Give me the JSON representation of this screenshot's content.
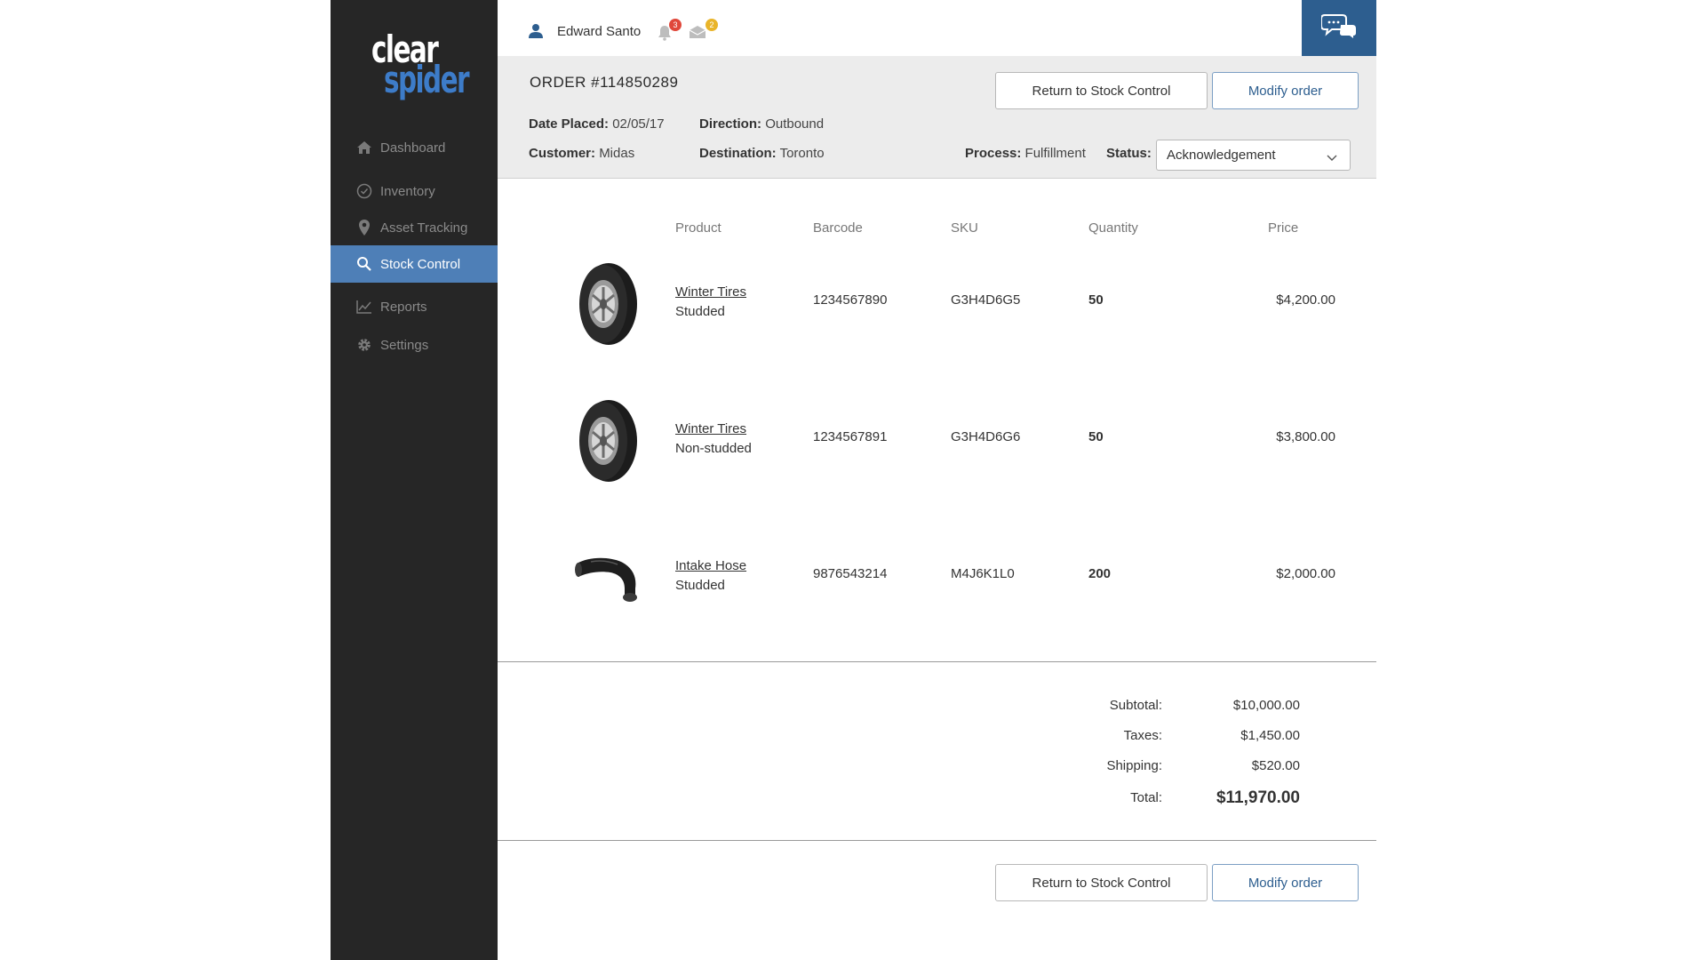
{
  "brand": {
    "logo_line1": "clear",
    "logo_line2": "spider",
    "accent": "#4e7fb7",
    "sidebar_bg": "#262626",
    "chat_bg": "#2d5e8f"
  },
  "sidebar": {
    "items": [
      {
        "label": "Dashboard",
        "icon": "home-icon",
        "active": false
      },
      {
        "label": "Inventory",
        "icon": "check-circle-icon",
        "active": false
      },
      {
        "label": "Asset Tracking",
        "icon": "map-pin-icon",
        "active": false
      },
      {
        "label": "Stock Control",
        "icon": "search-icon",
        "active": true
      },
      {
        "label": "Reports",
        "icon": "line-chart-icon",
        "active": false
      },
      {
        "label": "Settings",
        "icon": "gear-icon",
        "active": false
      }
    ]
  },
  "topbar": {
    "user_name": "Edward Santo",
    "notifications_count": "3",
    "messages_count": "2",
    "chat_icon": "chat-bubbles-icon"
  },
  "order": {
    "title": "ORDER #114850289",
    "date_placed_label": "Date Placed:",
    "date_placed": "02/05/17",
    "direction_label": "Direction:",
    "direction": "Outbound",
    "customer_label": "Customer:",
    "customer": "Midas",
    "destination_label": "Destination:",
    "destination": "Toronto",
    "process_label": "Process:",
    "process": "Fulfillment",
    "status_label": "Status:",
    "status": "Acknowledgement",
    "return_button": "Return to Stock Control",
    "modify_button": "Modify order"
  },
  "table": {
    "headers": {
      "product": "Product",
      "barcode": "Barcode",
      "sku": "SKU",
      "quantity": "Quantity",
      "price": "Price"
    },
    "rows": [
      {
        "name": "Winter Tires",
        "variant": "Studded",
        "barcode": "1234567890",
        "sku": "G3H4D6G5",
        "quantity": "50",
        "price": "$4,200.00",
        "image": "tire-image"
      },
      {
        "name": "Winter Tires",
        "variant": "Non-studded",
        "barcode": "1234567891",
        "sku": "G3H4D6G6",
        "quantity": "50",
        "price": "$3,800.00",
        "image": "tire-image"
      },
      {
        "name": "Intake Hose",
        "variant": "Studded",
        "barcode": "9876543214",
        "sku": "M4J6K1L0",
        "quantity": "200",
        "price": "$2,000.00",
        "image": "hose-image"
      }
    ]
  },
  "totals": {
    "subtotal_label": "Subtotal:",
    "subtotal": "$10,000.00",
    "taxes_label": "Taxes:",
    "taxes": "$1,450.00",
    "shipping_label": "Shipping:",
    "shipping": "$520.00",
    "total_label": "Total:",
    "total": "$11,970.00"
  },
  "footer": {
    "return_button": "Return to Stock Control",
    "modify_button": "Modify order"
  }
}
